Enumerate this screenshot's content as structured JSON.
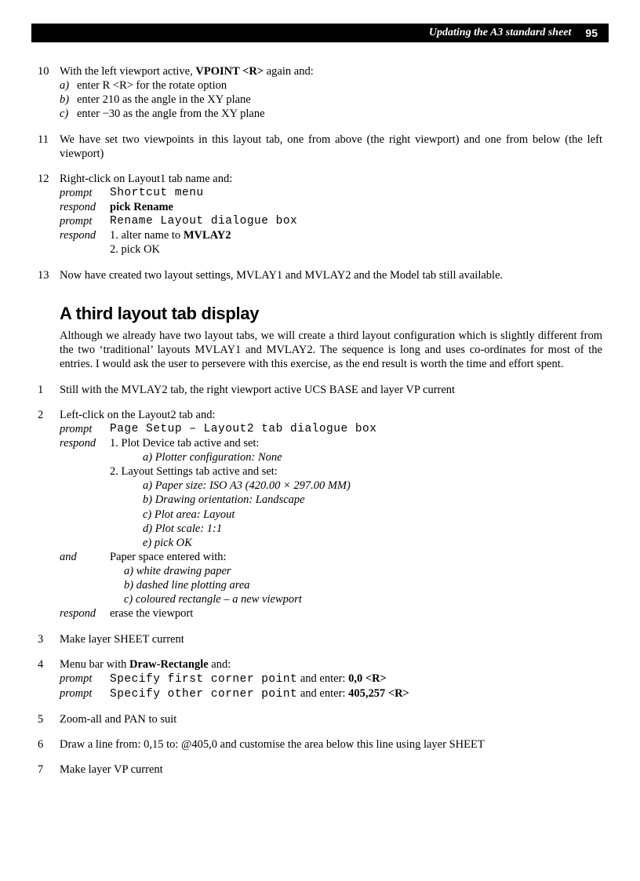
{
  "header": {
    "title": "Updating the A3 standard sheet",
    "page_number": "95"
  },
  "section_heading": "A third layout tab display",
  "items": {
    "i10": {
      "num": "10",
      "lead_pre": "With the left viewport active, ",
      "lead_bold": "VPOINT <R>",
      "lead_post": " again and:",
      "a": {
        "lbl": "a)",
        "txt": "enter R <R> for the rotate option"
      },
      "b": {
        "lbl": "b)",
        "txt": "enter 210 as the angle in the XY plane"
      },
      "c": {
        "lbl": "c)",
        "txt": "enter −30 as the angle from the XY plane"
      }
    },
    "i11": {
      "num": "11",
      "txt": "We have set two viewpoints in this layout tab, one from above (the right viewport) and one from below (the left viewport)"
    },
    "i12": {
      "num": "12",
      "lead": "Right-click on Layout1 tab name and:",
      "r1": {
        "lbl": "prompt",
        "txt": "Shortcut menu"
      },
      "r2": {
        "lbl": "respond",
        "txt": "pick Rename"
      },
      "r3": {
        "lbl": "prompt",
        "txt": "Rename Layout dialogue box"
      },
      "r4": {
        "lbl": "respond",
        "pre": "1. alter name to ",
        "bold": "MVLAY2"
      },
      "r5": {
        "txt": "2. pick OK"
      }
    },
    "i13": {
      "num": "13",
      "txt": "Now have created two layout settings, MVLAY1 and MVLAY2 and the Model tab still available."
    },
    "intro": {
      "txt": "Although we already have two layout tabs, we will create a third layout configuration which is slightly different from the two ‘traditional’ layouts MVLAY1 and MVLAY2. The sequence is long and uses co-ordinates for most of the entries. I would ask the user to persevere with this exercise, as the end result is worth the time and effort spent."
    },
    "s1": {
      "num": "1",
      "txt": "Still with the MVLAY2 tab, the right viewport active UCS BASE and layer VP current"
    },
    "s2": {
      "num": "2",
      "lead": "Left-click on the Layout2 tab and:",
      "r1": {
        "lbl": "prompt",
        "txt": "Page Setup – Layout2 tab dialogue box"
      },
      "r2": {
        "lbl": "respond",
        "txt": "1. Plot Device tab active and set:"
      },
      "r2a": {
        "txt": "a) Plotter configuration: None"
      },
      "r3": {
        "txt": "2. Layout Settings tab active and set:"
      },
      "r3a": {
        "txt": "a) Paper size: ISO A3 (420.00 × 297.00 MM)"
      },
      "r3b": {
        "txt": "b) Drawing orientation: Landscape"
      },
      "r3c": {
        "txt": "c) Plot area: Layout"
      },
      "r3d": {
        "txt": "d) Plot scale: 1:1"
      },
      "r3e": {
        "txt": "e) pick OK"
      },
      "r4": {
        "lbl": "and",
        "txt": "Paper space entered with:"
      },
      "r4a": {
        "txt": "a) white drawing paper"
      },
      "r4b": {
        "txt": "b) dashed line plotting area"
      },
      "r4c": {
        "txt": "c) coloured rectangle – a new viewport"
      },
      "r5": {
        "lbl": "respond",
        "txt": "erase the viewport"
      }
    },
    "s3": {
      "num": "3",
      "txt": "Make layer SHEET current"
    },
    "s4": {
      "num": "4",
      "lead_pre": "Menu bar with ",
      "lead_bold": "Draw-Rectangle",
      "lead_post": " and:",
      "r1": {
        "lbl": "prompt",
        "mono": "Specify first corner point",
        "mid": " and enter: ",
        "bold": "0,0 <R>"
      },
      "r2": {
        "lbl": "prompt",
        "mono": "Specify other corner point",
        "mid": " and enter: ",
        "bold": "405,257 <R>"
      }
    },
    "s5": {
      "num": "5",
      "txt": "Zoom-all and PAN to suit"
    },
    "s6": {
      "num": "6",
      "txt": "Draw a line from: 0,15 to: @405,0 and customise the area below this line using layer SHEET"
    },
    "s7": {
      "num": "7",
      "txt": "Make layer VP current"
    }
  }
}
